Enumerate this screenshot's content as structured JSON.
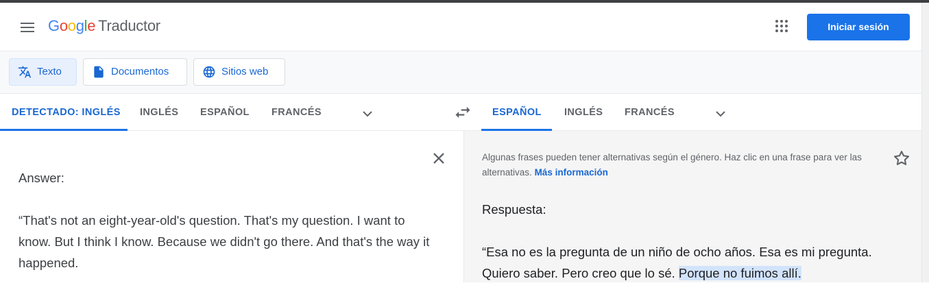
{
  "header": {
    "logo": {
      "G": "G",
      "o1": "o",
      "o2": "o",
      "g": "g",
      "l": "l",
      "e": "e"
    },
    "product": "Traductor",
    "signin_label": "Iniciar sesión"
  },
  "modes": [
    {
      "label": "Texto",
      "icon": "translate-icon",
      "active": true
    },
    {
      "label": "Documentos",
      "icon": "document-icon",
      "active": false
    },
    {
      "label": "Sitios web",
      "icon": "globe-icon",
      "active": false
    }
  ],
  "source_langs": [
    "DETECTADO: INGLÉS",
    "INGLÉS",
    "ESPAÑOL",
    "FRANCÉS"
  ],
  "target_langs": [
    "ESPAÑOL",
    "INGLÉS",
    "FRANCÉS"
  ],
  "source": {
    "paragraphs": [
      "Answer:",
      "“That's not an eight-year-old's question. That's my question. I want to know. But I think I know. Because we didn't go there. And that's the way it happened."
    ]
  },
  "target": {
    "notice": "Algunas frases pueden tener alternativas según el género. Haz clic en una frase para ver las alternativas.",
    "notice_link": "Más información",
    "paragraph1": "Respuesta:",
    "paragraph2_plain": "“Esa no es la pregunta de un niño de ocho años. Esa es mi pregunta. Quiero saber. Pero creo que lo sé. ",
    "paragraph2_highlight": "Porque no fuimos allí."
  },
  "colors": {
    "accent": "#1a73e8",
    "active_text": "#1967d2",
    "highlight": "#d2e3fc"
  }
}
